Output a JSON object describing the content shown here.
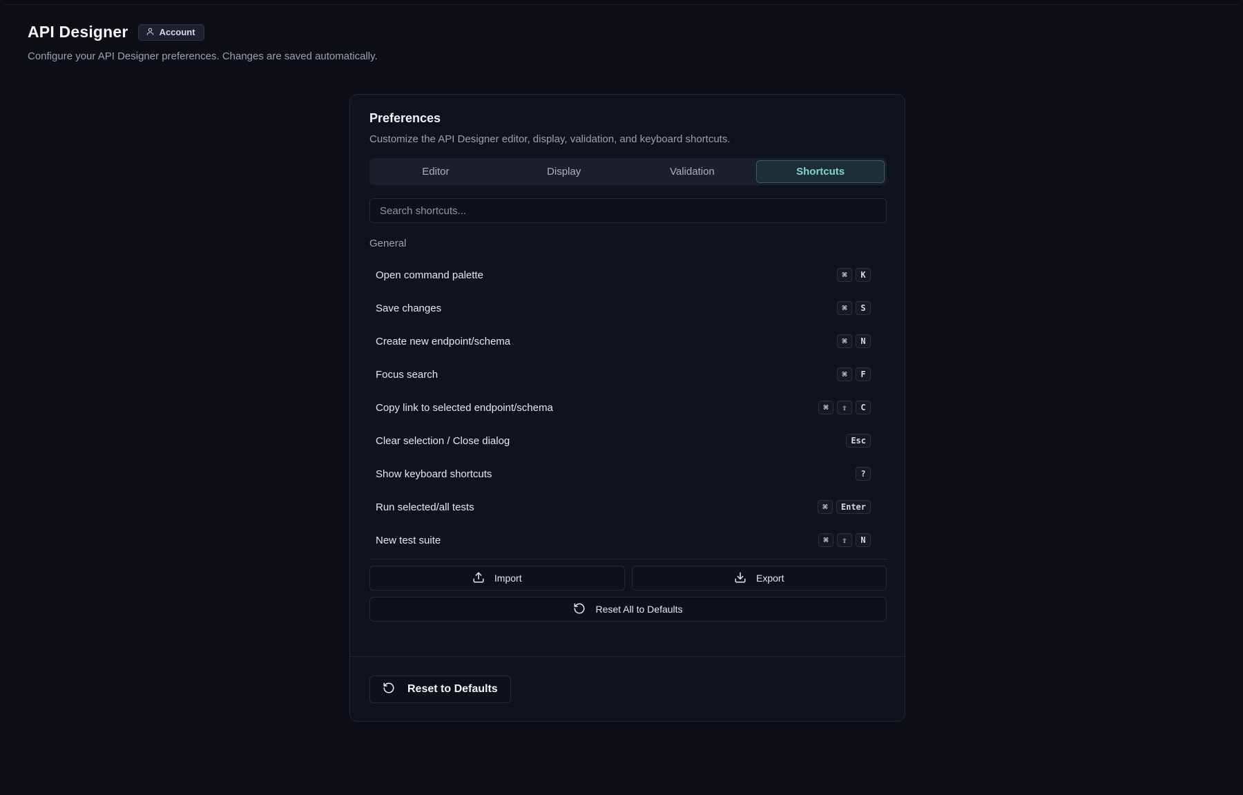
{
  "header": {
    "title": "API Designer",
    "account_label": "Account",
    "subtitle": "Configure your API Designer preferences. Changes are saved automatically."
  },
  "card": {
    "title": "Preferences",
    "description": "Customize the API Designer editor, display, validation, and keyboard shortcuts.",
    "tabs": [
      {
        "label": "Editor",
        "active": false
      },
      {
        "label": "Display",
        "active": false
      },
      {
        "label": "Validation",
        "active": false
      },
      {
        "label": "Shortcuts",
        "active": true
      }
    ],
    "search": {
      "placeholder": "Search shortcuts...",
      "value": ""
    },
    "group_label": "General",
    "shortcuts": [
      {
        "label": "Open command palette",
        "keys": [
          "⌘",
          "K"
        ]
      },
      {
        "label": "Save changes",
        "keys": [
          "⌘",
          "S"
        ]
      },
      {
        "label": "Create new endpoint/schema",
        "keys": [
          "⌘",
          "N"
        ]
      },
      {
        "label": "Focus search",
        "keys": [
          "⌘",
          "F"
        ]
      },
      {
        "label": "Copy link to selected endpoint/schema",
        "keys": [
          "⌘",
          "⇧",
          "C"
        ]
      },
      {
        "label": "Clear selection / Close dialog",
        "keys": [
          "Esc"
        ]
      },
      {
        "label": "Show keyboard shortcuts",
        "keys": [
          "?"
        ]
      },
      {
        "label": "Run selected/all tests",
        "keys": [
          "⌘",
          "Enter"
        ]
      },
      {
        "label": "New test suite",
        "keys": [
          "⌘",
          "⇧",
          "N"
        ]
      }
    ],
    "import_label": "Import",
    "export_label": "Export",
    "reset_all_label": "Reset All to Defaults",
    "reset_defaults_label": "Reset to Defaults"
  },
  "colors": {
    "background": "#0d0f15",
    "card": "#0f131b",
    "accent": "#7fd6cf"
  },
  "icons": {
    "account": "user-icon",
    "import": "upload-icon",
    "export": "download-icon",
    "reset": "rotate-ccw-icon"
  }
}
